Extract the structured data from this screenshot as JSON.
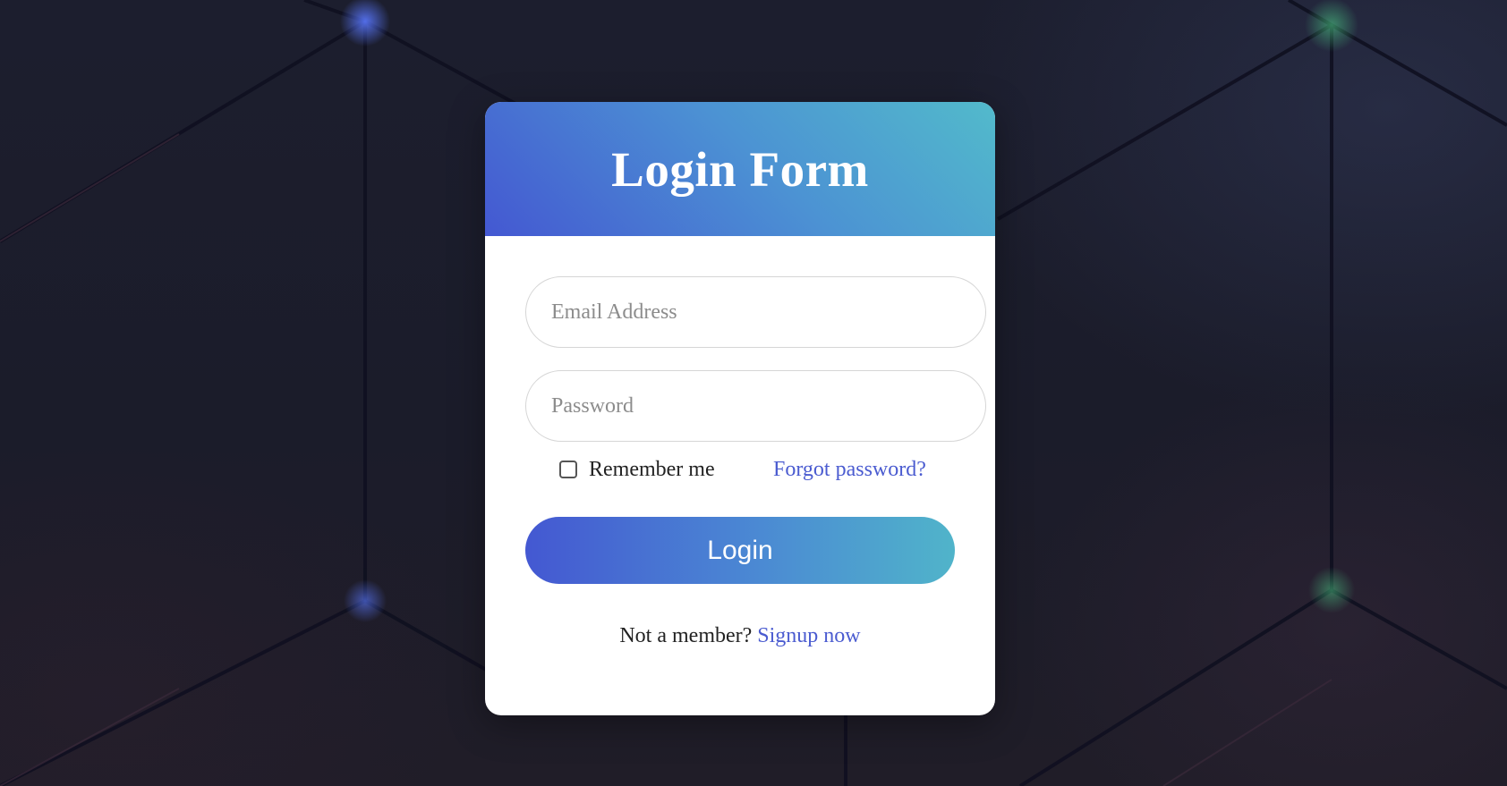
{
  "form": {
    "title": "Login Form",
    "email_placeholder": "Email Address",
    "password_placeholder": "Password",
    "remember_label": "Remember me",
    "remember_checked": false,
    "forgot_label": "Forgot password?",
    "login_label": "Login",
    "signup_prefix": "Not a member?",
    "signup_link": "Signup now"
  },
  "colors": {
    "gradient_start": "#4458d2",
    "gradient_end": "#52bacb",
    "link": "#4a5bd0",
    "background": "#1b1d2c"
  }
}
